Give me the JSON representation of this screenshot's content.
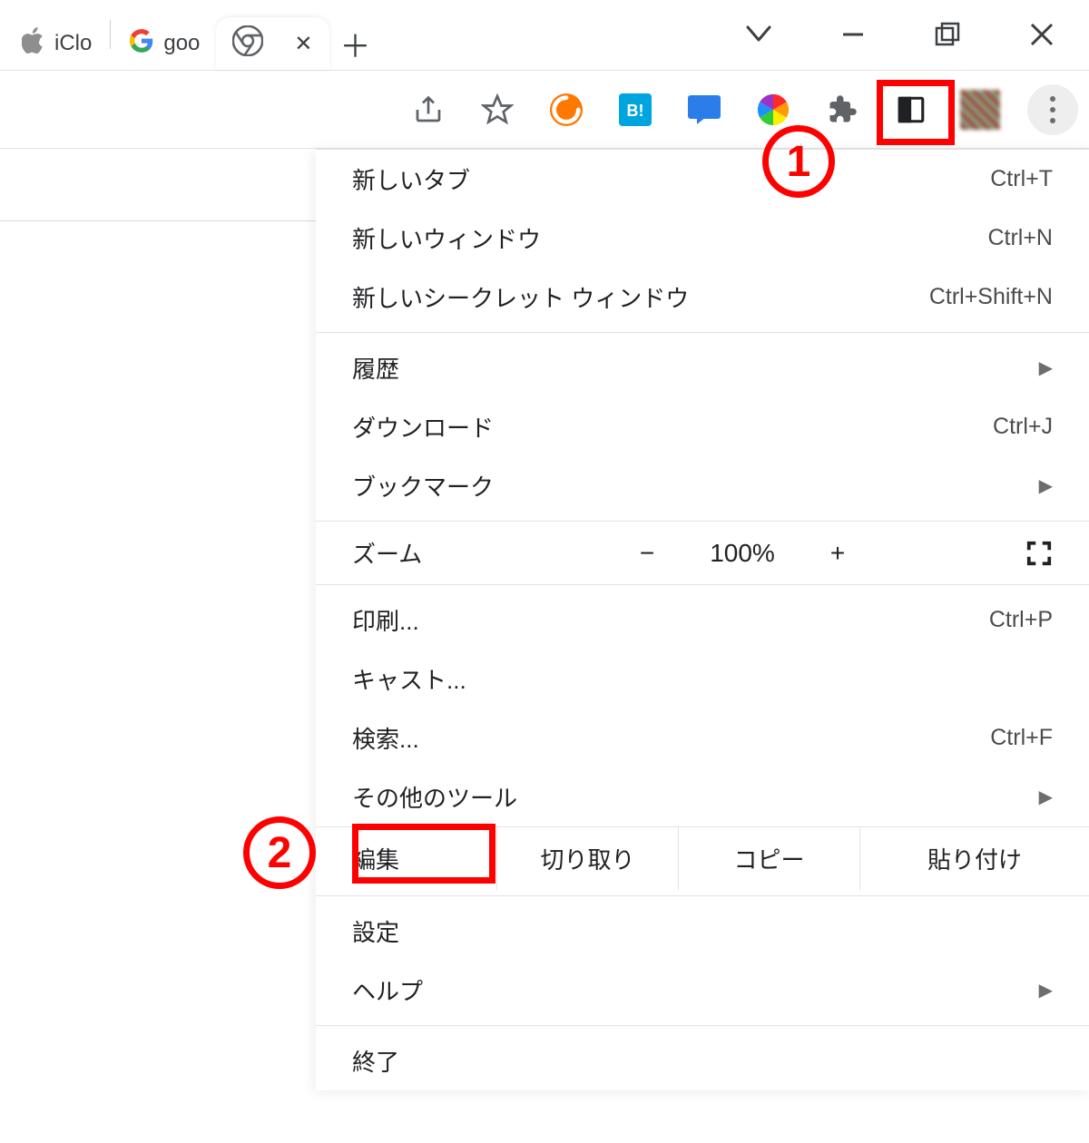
{
  "tabs": {
    "t1_label": "iClo",
    "t2_label": "goo"
  },
  "menu_items": {
    "new_tab": {
      "label": "新しいタブ",
      "shortcut": "Ctrl+T"
    },
    "new_window": {
      "label": "新しいウィンドウ",
      "shortcut": "Ctrl+N"
    },
    "new_incognito": {
      "label": "新しいシークレット ウィンドウ",
      "shortcut": "Ctrl+Shift+N"
    },
    "history": {
      "label": "履歴"
    },
    "downloads": {
      "label": "ダウンロード",
      "shortcut": "Ctrl+J"
    },
    "bookmarks": {
      "label": "ブックマーク"
    },
    "zoom_label": "ズーム",
    "zoom_minus": "−",
    "zoom_value": "100%",
    "zoom_plus": "+",
    "print": {
      "label": "印刷...",
      "shortcut": "Ctrl+P"
    },
    "cast": {
      "label": "キャスト..."
    },
    "find": {
      "label": "検索...",
      "shortcut": "Ctrl+F"
    },
    "more_tools": {
      "label": "その他のツール"
    },
    "edit_label": "編集",
    "cut": "切り取り",
    "copy": "コピー",
    "paste": "貼り付け",
    "settings": {
      "label": "設定"
    },
    "help": {
      "label": "ヘルプ"
    },
    "exit": {
      "label": "終了"
    }
  },
  "annotations": {
    "badge1": "1",
    "badge2": "2"
  }
}
